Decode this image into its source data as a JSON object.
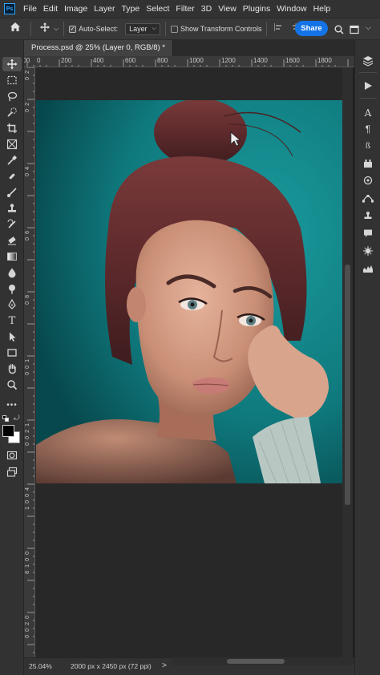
{
  "app": {
    "logo": "Ps"
  },
  "menu": [
    "File",
    "Edit",
    "Image",
    "Layer",
    "Type",
    "Select",
    "Filter",
    "3D",
    "View",
    "Plugins",
    "Window",
    "Help"
  ],
  "options": {
    "auto_select_label": "Auto-Select:",
    "auto_select_checked": "✓",
    "layer_select_value": "Layer",
    "transform_label": "Show Transform Controls",
    "share_label": "Share"
  },
  "document": {
    "tab_title": "Process.psd @ 25% (Layer 0, RGB/8) *"
  },
  "ruler_h": [
    "200",
    "0",
    "200",
    "400",
    "600",
    "800",
    "1000",
    "1200",
    "1400",
    "1600",
    "1800"
  ],
  "ruler_v": [
    "2",
    "0",
    "2",
    "0",
    "4",
    "0",
    "6",
    "0",
    "8",
    "0",
    "1",
    "0",
    "0",
    "1",
    "2",
    "0",
    "0",
    "1",
    "4",
    "0",
    "0",
    "1",
    "6",
    "0",
    "0",
    "1",
    "8",
    "0",
    "0",
    "2",
    "0",
    "0",
    "0",
    "2",
    "2",
    "0",
    "0",
    "2",
    "4",
    "0",
    "0",
    "2",
    "6",
    "0",
    "0",
    "2",
    "8",
    "0",
    "0"
  ],
  "status": {
    "zoom": "25.04%",
    "doc_info": "2000 px x 2450 px (72 ppi)",
    "arrow": ">"
  },
  "colors": {
    "accent": "#1473e6",
    "teal_bg": "#0f7378",
    "hair": "#6a2e2e",
    "skin": "#d9a48c"
  },
  "tools": [
    "move-tool",
    "marquee-tool",
    "lasso-tool",
    "quick-select-tool",
    "crop-tool",
    "frame-tool",
    "eyedropper-tool",
    "healing-brush-tool",
    "brush-tool",
    "clone-stamp-tool",
    "history-brush-tool",
    "eraser-tool",
    "gradient-tool",
    "blur-tool",
    "dodge-tool",
    "pen-tool",
    "type-tool",
    "path-select-tool",
    "rectangle-tool",
    "hand-tool",
    "zoom-tool",
    "more-tools",
    "colors",
    "quick-mask",
    "screen-mode"
  ],
  "right_panel": [
    "layers-icon",
    "play-icon",
    "character-icon",
    "paragraph-icon",
    "glyphs-icon",
    "properties-icon",
    "3d-icon",
    "paths-icon",
    "clone-source-icon",
    "comments-icon",
    "brush-settings-icon",
    "histogram-icon"
  ]
}
